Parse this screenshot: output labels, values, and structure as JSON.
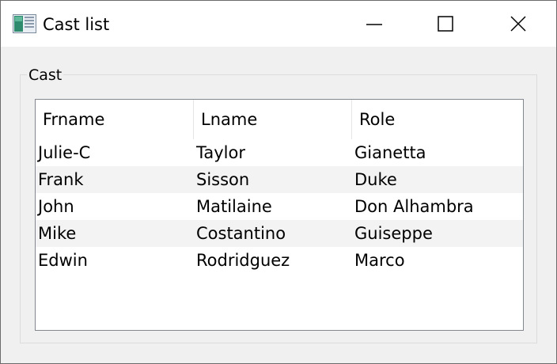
{
  "window": {
    "title": "Cast list",
    "icon": "app-window-icon",
    "controls": {
      "minimize": "minimize-icon",
      "maximize": "maximize-icon",
      "close": "close-icon"
    }
  },
  "group": {
    "title": "Cast"
  },
  "table": {
    "columns": [
      "Frname",
      "Lname",
      "Role"
    ],
    "rows": [
      [
        "Julie-C",
        "Taylor",
        "Gianetta"
      ],
      [
        "Frank",
        "Sisson",
        "Duke"
      ],
      [
        "John",
        "Matilaine",
        "Don Alhambra"
      ],
      [
        "Mike",
        "Costantino",
        "Guiseppe"
      ],
      [
        "Edwin",
        "Rodridguez",
        "Marco"
      ]
    ]
  },
  "colors": {
    "accent": "#2e8b6e",
    "alternate_row": "#f3f3f3",
    "border": "#828790"
  }
}
